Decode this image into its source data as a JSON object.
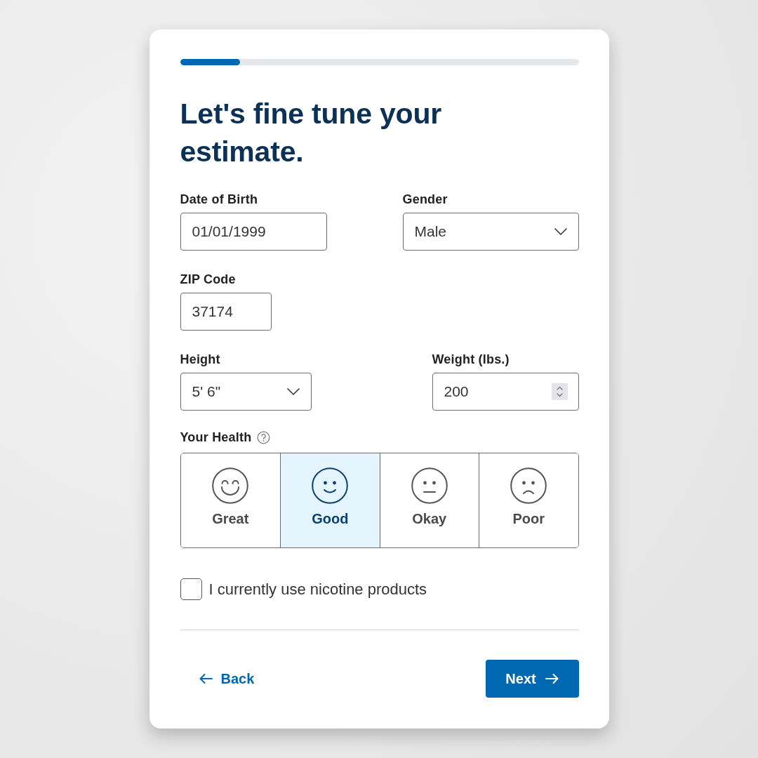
{
  "progress": {
    "level": 0.15
  },
  "title": "Let's fine tune your estimate.",
  "form_rows": [
    [
      {
        "kind": "text",
        "label": "Date of Birth",
        "value": "01/01/1999"
      },
      {
        "kind": "select",
        "label": "Gender",
        "value": "Male"
      }
    ],
    [
      {
        "kind": "text",
        "label": "ZIP Code",
        "value": "37174"
      }
    ],
    [
      {
        "kind": "select",
        "label": "Height",
        "value": "5' 6\""
      },
      {
        "kind": "number",
        "label": "Weight (lbs.)",
        "value": "200"
      }
    ]
  ],
  "health": {
    "label": "Your Health",
    "options": [
      {
        "kind": "great",
        "label": "Great",
        "selected": false
      },
      {
        "kind": "good",
        "label": "Good",
        "selected": true
      },
      {
        "kind": "okay",
        "label": "Okay",
        "selected": false
      },
      {
        "kind": "poor",
        "label": "Poor",
        "selected": false
      }
    ]
  },
  "nicotine": {
    "label": "I currently use nicotine products",
    "checked": false
  },
  "back_button": {
    "label": "Back"
  },
  "next_button": {
    "label": "Next"
  }
}
